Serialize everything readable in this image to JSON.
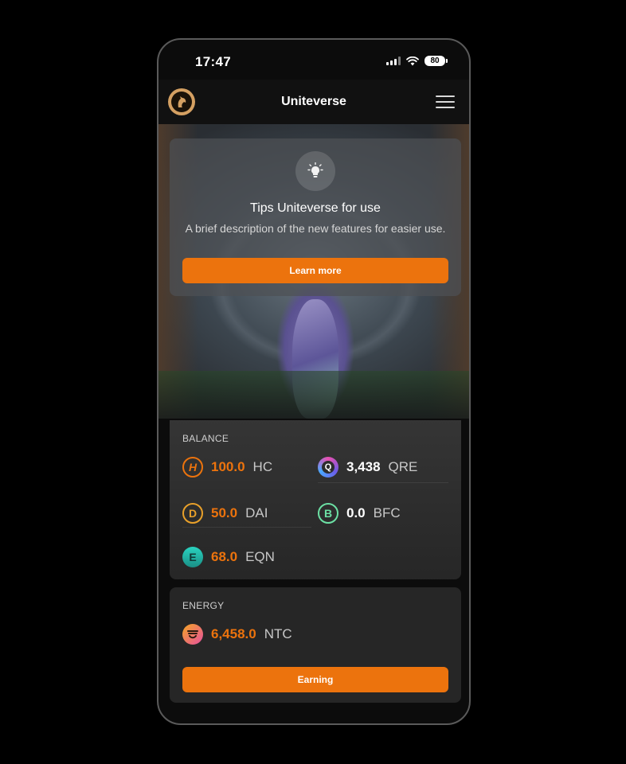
{
  "status_bar": {
    "time": "17:47",
    "battery": "80"
  },
  "navbar": {
    "title": "Uniteverse"
  },
  "tips": {
    "title": "Tips Uniteverse for use",
    "description": "A brief description of the new features for easier use.",
    "button_label": "Learn more"
  },
  "balance": {
    "label": "BALANCE",
    "coins": [
      {
        "symbol": "H",
        "amount": "100.0",
        "unit": "HC"
      },
      {
        "symbol": "Q",
        "amount": "3,438",
        "unit": "QRE"
      },
      {
        "symbol": "D",
        "amount": "50.0",
        "unit": "DAI"
      },
      {
        "symbol": "B",
        "amount": "0.0",
        "unit": "BFC"
      },
      {
        "symbol": "E",
        "amount": "68.0",
        "unit": "EQN"
      }
    ]
  },
  "energy": {
    "label": "ENERGY",
    "coin": {
      "amount": "6,458.0",
      "unit": "NTC"
    },
    "button_label": "Earning"
  },
  "colors": {
    "accent": "#ec730d",
    "background": "#000000",
    "card": "#262626"
  }
}
